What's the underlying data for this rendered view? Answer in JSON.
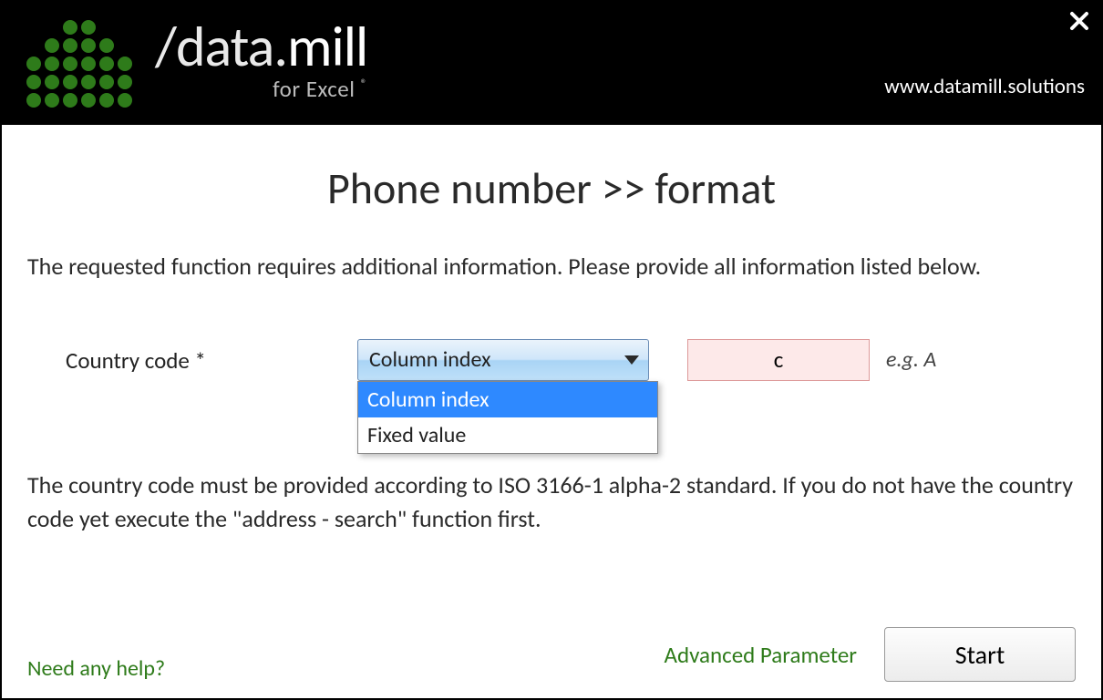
{
  "header": {
    "logo_text_prefix": "/data.",
    "logo_text_bold": "mill",
    "logo_sub": "for Excel",
    "url": "www.datamill.solutions"
  },
  "page": {
    "title": "Phone number >> format",
    "intro": "The requested function requires additional information. Please provide all information listed below."
  },
  "form": {
    "country_label": "Country code *",
    "dropdown_selected": "Column index",
    "dropdown_options": [
      "Column index",
      "Fixed value"
    ],
    "input_value": "c",
    "input_hint": "e.g. A",
    "help_text": "The country code must be provided according to ISO 3166-1 alpha-2 standard. If you do not have the country code yet execute the \"address - search\" function first."
  },
  "footer": {
    "help_link": "Need any help?",
    "advanced_link": "Advanced Parameter",
    "start_button": "Start"
  }
}
